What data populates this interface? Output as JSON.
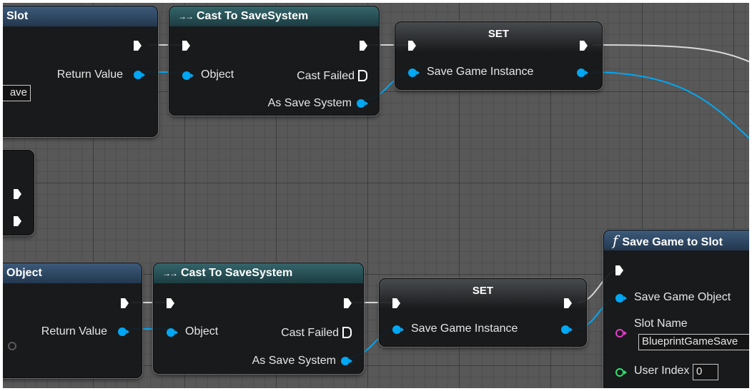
{
  "colors": {
    "grid_background": "#585858",
    "object_pin": "#00a8f4",
    "string_pin": "#e43cc8",
    "integer_pin": "#30e070",
    "cast_header": "#2a5157",
    "function_header": "#2e4a66"
  },
  "top_left_node": {
    "title": "Slot",
    "return_value_label": "Return Value",
    "field_fragment": "ave"
  },
  "mid_left_node": {},
  "bottom_left_node": {
    "title": "Object",
    "return_value_label": "Return Value"
  },
  "cast_top": {
    "title": "Cast To SaveSystem",
    "object_label": "Object",
    "cast_failed_label": "Cast Failed",
    "as_save_system_label": "As Save System"
  },
  "cast_bottom": {
    "title": "Cast To SaveSystem",
    "object_label": "Object",
    "cast_failed_label": "Cast Failed",
    "as_save_system_label": "As Save System"
  },
  "set_top": {
    "title": "SET",
    "variable_label": "Save Game Instance"
  },
  "set_bottom": {
    "title": "SET",
    "variable_label": "Save Game Instance"
  },
  "save_game_to_slot": {
    "title": "Save Game to Slot",
    "save_game_object_label": "Save Game Object",
    "slot_name_label": "Slot Name",
    "slot_name_value": "BlueprintGameSave",
    "user_index_label": "User Index",
    "user_index_value": "0"
  }
}
